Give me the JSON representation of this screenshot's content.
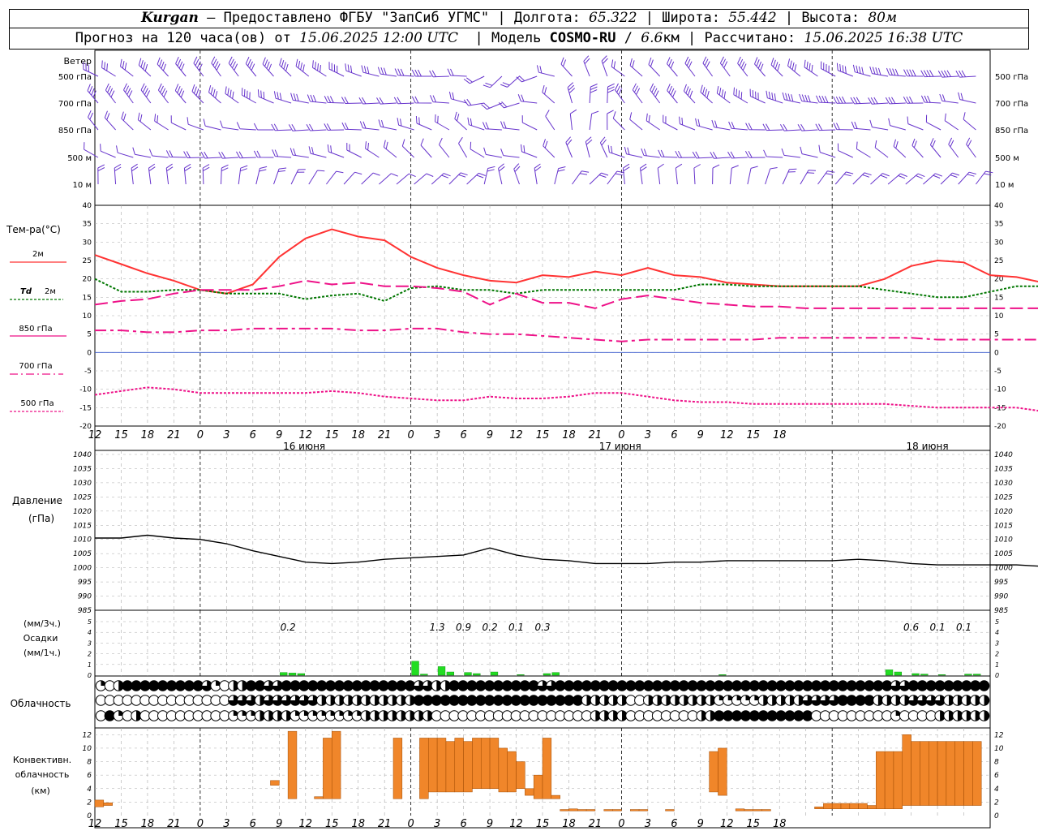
{
  "header": {
    "station": "Kurgan",
    "dash": " – ",
    "provider": "Предоставлено ФГБУ \"ЗапСиб УГМС\"",
    "lon_label": "Долгота:",
    "lon_value": "65.322",
    "lat_label": "Широта:",
    "lat_value": "55.442",
    "alt_label": "Высота:",
    "alt_value": "80м",
    "forecast_prefix": "Прогноз на 120 часа(ов) от",
    "forecast_start": "15.06.2025 12:00 UTC",
    "model_label": "Модель",
    "model_name": "COSMO-RU",
    "model_res_value": "6.6",
    "model_res_unit": "км",
    "calc_label": "Рассчитано:",
    "calc_time": "15.06.2025 16:38 UTC"
  },
  "panels": {
    "wind": {
      "title": "Ветер",
      "levels": [
        "500 гПа",
        "700 гПа",
        "850 гПа",
        "500 м",
        "10 м"
      ]
    },
    "temp": {
      "title": "Тем-ра(°С)",
      "legend": [
        {
          "label": "2м",
          "color": "#ff3333",
          "dash": "none"
        },
        {
          "label_a": "Td",
          "label_b": "2м",
          "color": "#007700",
          "dash": "3,2"
        },
        {
          "label": "850 гПа",
          "color": "#ee1188",
          "dash": "14,6"
        },
        {
          "label": "700 гПа",
          "color": "#ee1188",
          "dash": "12,4,3,4"
        },
        {
          "label": "500 гПа",
          "color": "#ee1188",
          "dash": "3,2"
        }
      ],
      "ticks": [
        "40",
        "35",
        "30",
        "25",
        "20",
        "15",
        "10",
        "5",
        "0",
        "-5",
        "-10",
        "-15",
        "-20"
      ]
    },
    "pressure": {
      "title_a": "Давление",
      "title_b": "(гПа)",
      "ticks": [
        "1040",
        "1035",
        "1030",
        "1025",
        "1020",
        "1015",
        "1010",
        "1005",
        "1000",
        "995",
        "990",
        "985"
      ]
    },
    "precip": {
      "unit_a": "(мм/3ч.)",
      "title": "Осадки",
      "unit_b": "(мм/1ч.)",
      "ticks": [
        "5",
        "4",
        "3",
        "2",
        "1",
        "0"
      ]
    },
    "clouds": {
      "title": "Облачность"
    },
    "convective": {
      "title_a": "Конвективн.",
      "title_b": "облачность",
      "title_c": "(км)",
      "ticks": [
        "12",
        "10",
        "8",
        "6",
        "4",
        "2",
        "0"
      ]
    }
  },
  "time_axis": {
    "hour_labels": [
      "12",
      "15",
      "18",
      "21",
      "0",
      "3",
      "6",
      "9",
      "12",
      "15",
      "18",
      "21",
      "0",
      "3",
      "6",
      "9",
      "12",
      "15",
      "18",
      "21",
      "0",
      "3",
      "6",
      "9",
      "12",
      "15",
      "18"
    ],
    "date_labels": [
      "16 июня",
      "17 июня",
      "18 июня"
    ]
  },
  "chart_data": [
    {
      "type": "line",
      "id": "temperature",
      "x_start": "15.06.2025 12:00 UTC",
      "x_step_hours": 3,
      "ylim": [
        -20,
        40
      ],
      "series": [
        {
          "name": "2м",
          "values": [
            26.5,
            24,
            21.5,
            19.5,
            17,
            16,
            18.5,
            26,
            31,
            33.5,
            31.5,
            30.5,
            26,
            23,
            21,
            19.5,
            19,
            21,
            20.5,
            22,
            21,
            23,
            21,
            20.5,
            19,
            18.5,
            18,
            18,
            18,
            18,
            20,
            23.5,
            25,
            24.5,
            21,
            20.5,
            19
          ]
        },
        {
          "name": "Td 2м",
          "values": [
            20,
            16.5,
            16.5,
            17,
            17,
            16,
            16,
            16,
            14.5,
            15.5,
            16,
            14,
            17.5,
            18,
            17,
            17,
            16,
            17,
            17,
            17,
            17,
            17,
            17,
            18.5,
            18.5,
            18,
            18,
            18,
            18,
            18,
            17,
            16,
            15,
            15,
            16.5,
            18,
            18
          ]
        },
        {
          "name": "850 гПа",
          "values": [
            13,
            14,
            14.5,
            16,
            17,
            17,
            17,
            18,
            19.5,
            18.5,
            19,
            18,
            18,
            17.5,
            16.5,
            13,
            16,
            13.5,
            13.5,
            12,
            14.5,
            15.5,
            14.5,
            13.5,
            13,
            12.5,
            12.5,
            12,
            12,
            12,
            12,
            12,
            12,
            12,
            12,
            12,
            12
          ]
        },
        {
          "name": "700 гПа",
          "values": [
            6,
            6,
            5.5,
            5.5,
            6,
            6,
            6.5,
            6.5,
            6.5,
            6.5,
            6,
            6,
            6.5,
            6.5,
            5.5,
            5,
            5,
            4.5,
            4,
            3.5,
            3,
            3.5,
            3.5,
            3.5,
            3.5,
            3.5,
            4,
            4,
            4,
            4,
            4,
            4,
            3.5,
            3.5,
            3.5,
            3.5,
            3.5
          ]
        },
        {
          "name": "500 гПа",
          "values": [
            -11.5,
            -10.5,
            -9.5,
            -10,
            -11,
            -11,
            -11,
            -11,
            -11,
            -10.5,
            -11,
            -12,
            -12.5,
            -13,
            -13,
            -12,
            -12.5,
            -12.5,
            -12,
            -11,
            -11,
            -12,
            -13,
            -13.5,
            -13.5,
            -14,
            -14,
            -14,
            -14,
            -14,
            -14,
            -14.5,
            -15,
            -15,
            -15,
            -15,
            -16
          ]
        }
      ]
    },
    {
      "type": "line",
      "id": "pressure",
      "x_start": "15.06.2025 12:00 UTC",
      "x_step_hours": 3,
      "ylim": [
        985,
        1040
      ],
      "series": [
        {
          "name": "Давление",
          "values": [
            1010.5,
            1010.5,
            1011.5,
            1010.5,
            1010,
            1008.5,
            1006,
            1004,
            1002,
            1001.5,
            1002,
            1003,
            1003.5,
            1004,
            1004.5,
            1007,
            1004.5,
            1003,
            1002.5,
            1001.5,
            1001.5,
            1001.5,
            1002,
            1002,
            1002.5,
            1002.5,
            1002.5,
            1002.5,
            1002.5,
            1003,
            1002.5,
            1001.5,
            1001,
            1001,
            1001,
            1001,
            1000.5
          ]
        }
      ]
    },
    {
      "type": "bar",
      "id": "precipitation",
      "x_start": "15.06.2025 12:00 UTC",
      "x_step_hours": 1,
      "ylim": [
        0,
        5
      ],
      "hourly_bars": [
        [
          21,
          0.25
        ],
        [
          22,
          0.2
        ],
        [
          23,
          0.15
        ],
        [
          36,
          1.3
        ],
        [
          37,
          0.1
        ],
        [
          39,
          0.8
        ],
        [
          40,
          0.3
        ],
        [
          42,
          0.25
        ],
        [
          43,
          0.15
        ],
        [
          45,
          0.3
        ],
        [
          48,
          0.05
        ],
        [
          51,
          0.15
        ],
        [
          52,
          0.25
        ],
        [
          71,
          0.05
        ],
        [
          90,
          0.5
        ],
        [
          91,
          0.3
        ],
        [
          93,
          0.15
        ],
        [
          94,
          0.1
        ],
        [
          96,
          0.05
        ],
        [
          99,
          0.1
        ],
        [
          100,
          0.1
        ]
      ],
      "three_hour_totals": [
        {
          "hour": 22,
          "value": "0.2"
        },
        {
          "hour": 39,
          "value": "1.3"
        },
        {
          "hour": 42,
          "value": "0.9"
        },
        {
          "hour": 45,
          "value": "0.2"
        },
        {
          "hour": 48,
          "value": "0.1"
        },
        {
          "hour": 51,
          "value": "0.3"
        },
        {
          "hour": 93,
          "value": "0.6"
        },
        {
          "hour": 96,
          "value": "0.1"
        },
        {
          "hour": 99,
          "value": "0.1"
        }
      ]
    },
    {
      "type": "table",
      "id": "cloudiness",
      "x_start": "15.06.2025 12:00 UTC",
      "x_step_hours": 1,
      "rows": [
        {
          "segments": [
            [
              0,
              1,
              "q"
            ],
            [
              1,
              2,
              "e"
            ],
            [
              2,
              3,
              "h"
            ],
            [
              3,
              12,
              "f"
            ],
            [
              12,
              13,
              "t"
            ],
            [
              13,
              14,
              "q"
            ],
            [
              14,
              15,
              "e"
            ],
            [
              15,
              17,
              "h"
            ],
            [
              17,
              19,
              "f"
            ],
            [
              19,
              21,
              "t"
            ],
            [
              21,
              36,
              "f"
            ],
            [
              36,
              38,
              "t"
            ],
            [
              38,
              40,
              "h"
            ],
            [
              40,
              50,
              "f"
            ],
            [
              50,
              52,
              "t"
            ],
            [
              52,
              62,
              "f"
            ],
            [
              62,
              70,
              "f"
            ],
            [
              70,
              80,
              "f"
            ],
            [
              80,
              90,
              "f"
            ],
            [
              90,
              92,
              "t"
            ],
            [
              92,
              101,
              "f"
            ]
          ]
        },
        {
          "segments": [
            [
              0,
              15,
              "e"
            ],
            [
              15,
              18,
              "t"
            ],
            [
              18,
              19,
              "h"
            ],
            [
              19,
              25,
              "t"
            ],
            [
              25,
              26,
              "h"
            ],
            [
              26,
              28,
              "h"
            ],
            [
              28,
              34,
              "h"
            ],
            [
              34,
              36,
              "h"
            ],
            [
              36,
              55,
              "f"
            ],
            [
              55,
              60,
              "h"
            ],
            [
              60,
              62,
              "e"
            ],
            [
              62,
              70,
              "h"
            ],
            [
              70,
              75,
              "q"
            ],
            [
              75,
              80,
              "h"
            ],
            [
              80,
              84,
              "t"
            ],
            [
              84,
              88,
              "f"
            ],
            [
              88,
              92,
              "h"
            ],
            [
              92,
              96,
              "t"
            ],
            [
              96,
              101,
              "h"
            ]
          ]
        },
        {
          "segments": [
            [
              0,
              1,
              "e"
            ],
            [
              1,
              2,
              "f"
            ],
            [
              2,
              3,
              "q"
            ],
            [
              3,
              4,
              "e"
            ],
            [
              4,
              5,
              "h"
            ],
            [
              5,
              15,
              "e"
            ],
            [
              15,
              18,
              "q"
            ],
            [
              18,
              20,
              "h"
            ],
            [
              20,
              22,
              "h"
            ],
            [
              22,
              30,
              "q"
            ],
            [
              30,
              34,
              "h"
            ],
            [
              34,
              38,
              "h"
            ],
            [
              38,
              43,
              "e"
            ],
            [
              43,
              56,
              "e"
            ],
            [
              56,
              57,
              "h"
            ],
            [
              57,
              60,
              "h"
            ],
            [
              60,
              68,
              "e"
            ],
            [
              68,
              70,
              "h"
            ],
            [
              70,
              81,
              "f"
            ],
            [
              81,
              90,
              "e"
            ],
            [
              90,
              91,
              "q"
            ],
            [
              91,
              95,
              "e"
            ],
            [
              95,
              96,
              "h"
            ],
            [
              96,
              99,
              "h"
            ],
            [
              99,
              101,
              "h"
            ]
          ]
        }
      ]
    },
    {
      "type": "bar",
      "id": "convective_cloud",
      "x_start": "15.06.2025 12:00 UTC",
      "x_step_hours": 1,
      "ylim": [
        0,
        13
      ],
      "bars": [
        [
          0,
          1,
          1.3,
          2.3
        ],
        [
          1,
          2,
          1.5,
          1.9
        ],
        [
          20,
          21,
          4.5,
          5.2
        ],
        [
          22,
          23,
          2.5,
          12.5
        ],
        [
          25,
          26,
          2.5,
          2.8
        ],
        [
          26,
          27,
          2.5,
          11.5
        ],
        [
          27,
          28,
          2.5,
          12.5
        ],
        [
          34,
          35,
          2.5,
          11.5
        ],
        [
          37,
          38,
          2.5,
          11.5
        ],
        [
          38,
          39,
          3.5,
          11.5
        ],
        [
          39,
          40,
          3.5,
          11.5
        ],
        [
          40,
          41,
          3.5,
          11
        ],
        [
          41,
          42,
          3.5,
          11.5
        ],
        [
          42,
          43,
          3.5,
          11
        ],
        [
          43,
          44,
          4,
          11.5
        ],
        [
          44,
          45,
          4,
          11.5
        ],
        [
          45,
          46,
          4,
          11.5
        ],
        [
          46,
          47,
          3.5,
          10
        ],
        [
          47,
          48,
          3.5,
          9.5
        ],
        [
          48,
          49,
          4,
          8
        ],
        [
          49,
          50,
          3,
          4
        ],
        [
          50,
          51,
          2.5,
          6
        ],
        [
          51,
          52,
          2.5,
          11.5
        ],
        [
          52,
          53,
          2.5,
          3
        ],
        [
          53,
          54,
          0.7,
          0.9
        ],
        [
          54,
          55,
          0.7,
          1
        ],
        [
          55,
          56,
          0.7,
          0.9
        ],
        [
          56,
          57,
          0.7,
          0.9
        ],
        [
          58,
          59,
          0.7,
          0.9
        ],
        [
          59,
          60,
          0.7,
          0.9
        ],
        [
          61,
          62,
          0.7,
          0.9
        ],
        [
          62,
          63,
          0.7,
          0.9
        ],
        [
          65,
          66,
          0.7,
          0.9
        ],
        [
          70,
          71,
          3.5,
          9.5
        ],
        [
          71,
          72,
          3,
          10
        ],
        [
          73,
          74,
          0.7,
          1
        ],
        [
          74,
          75,
          0.7,
          0.9
        ],
        [
          75,
          76,
          0.7,
          0.9
        ],
        [
          76,
          77,
          0.7,
          0.9
        ],
        [
          82,
          83,
          1,
          1.3
        ],
        [
          83,
          84,
          1,
          1.8
        ],
        [
          84,
          85,
          1,
          1.8
        ],
        [
          85,
          86,
          1,
          1.8
        ],
        [
          86,
          87,
          1,
          1.8
        ],
        [
          87,
          88,
          1,
          1.8
        ],
        [
          88,
          89,
          1,
          1.5
        ],
        [
          89,
          90,
          1,
          9.5
        ],
        [
          90,
          91,
          1,
          9.5
        ],
        [
          91,
          92,
          1,
          9.5
        ],
        [
          92,
          93,
          1.5,
          12
        ],
        [
          93,
          94,
          1.5,
          11
        ],
        [
          94,
          95,
          1.5,
          11
        ],
        [
          95,
          96,
          1.5,
          11
        ],
        [
          96,
          97,
          1.5,
          11
        ],
        [
          97,
          98,
          1.5,
          11
        ],
        [
          98,
          99,
          1.5,
          11
        ],
        [
          99,
          100,
          1.5,
          11
        ],
        [
          100,
          101,
          1.5,
          11
        ]
      ]
    }
  ]
}
